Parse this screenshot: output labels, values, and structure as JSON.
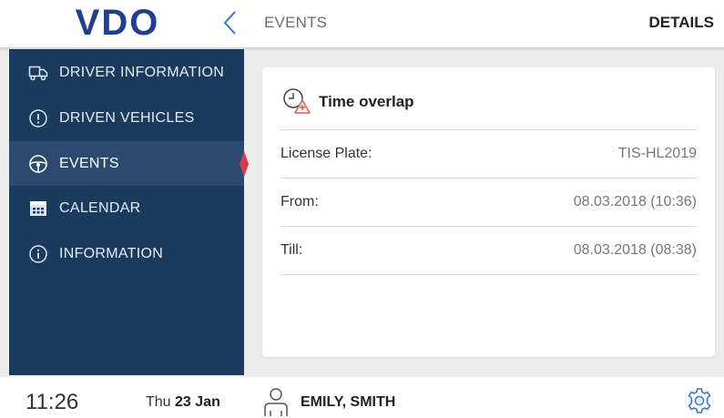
{
  "header": {
    "logo_text": "VDO",
    "title": "EVENTS",
    "details_label": "DETAILS"
  },
  "sidebar": {
    "items": [
      {
        "label": "DRIVER INFORMATION",
        "icon": "truck-icon",
        "active": false
      },
      {
        "label": "DRIVEN VEHICLES",
        "icon": "alert-circle-icon",
        "active": false
      },
      {
        "label": "EVENTS",
        "icon": "steering-wheel-icon",
        "active": true
      },
      {
        "label": "CALENDAR",
        "icon": "calendar-icon",
        "active": false
      },
      {
        "label": "INFORMATION",
        "icon": "info-icon",
        "active": false
      }
    ]
  },
  "event": {
    "title": "Time overlap",
    "icon": "clock-warning-icon",
    "fields": [
      {
        "label": "License Plate:",
        "value": "TIS-HL2019"
      },
      {
        "label": "From:",
        "value": "08.03.2018 (10:36)"
      },
      {
        "label": "Till:",
        "value": "08.03.2018 (08:38)"
      }
    ]
  },
  "footer": {
    "time": "11:26",
    "day": "Thu",
    "date": "23 Jan",
    "user": "EMILY, SMITH"
  },
  "colors": {
    "sidebar_bg": "#1a3a5e",
    "sidebar_active": "#2c4a70",
    "accent_red": "#d93a52",
    "logo_blue": "#1f3f8f",
    "link_blue": "#3b78c4"
  }
}
